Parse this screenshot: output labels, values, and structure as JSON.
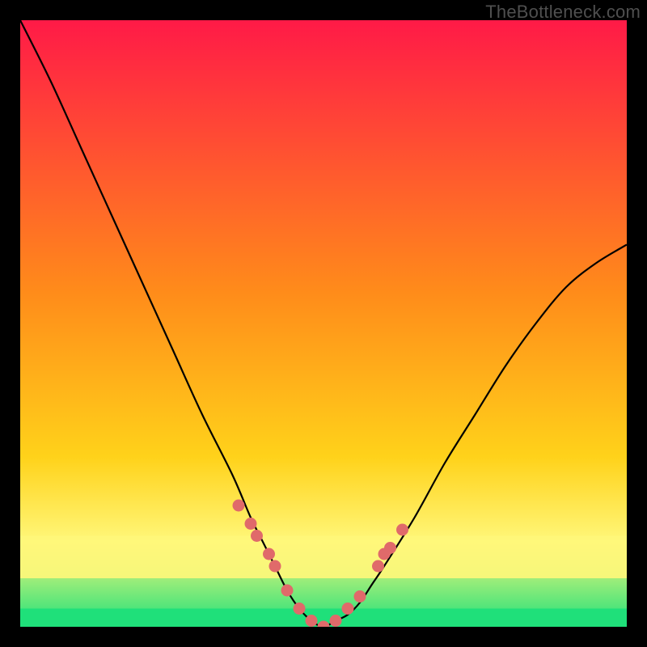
{
  "watermark": "TheBottleneck.com",
  "colors": {
    "frame": "#000000",
    "grad_top": "#ff1a47",
    "grad_mid": "#ffd21a",
    "grad_yellowband": "#fff77a",
    "grad_bottom": "#1fe07a",
    "curve": "#000000",
    "dots": "#e06a6a"
  },
  "chart_data": {
    "type": "line",
    "title": "",
    "xlabel": "",
    "ylabel": "",
    "xlim": [
      0,
      100
    ],
    "ylim": [
      0,
      100
    ],
    "series": [
      {
        "name": "bottleneck-curve",
        "x": [
          0,
          5,
          10,
          15,
          20,
          25,
          30,
          35,
          38,
          40,
          42,
          44,
          46,
          48,
          50,
          52,
          54,
          56,
          58,
          60,
          65,
          70,
          75,
          80,
          85,
          90,
          95,
          100
        ],
        "y": [
          100,
          90,
          79,
          68,
          57,
          46,
          35,
          25,
          18,
          14,
          10,
          6,
          3,
          1,
          0,
          1,
          2,
          4,
          7,
          10,
          18,
          27,
          35,
          43,
          50,
          56,
          60,
          63
        ]
      }
    ],
    "markers": {
      "name": "highlight-dots",
      "x": [
        36,
        38,
        39,
        41,
        42,
        44,
        46,
        48,
        50,
        52,
        54,
        56,
        59,
        60,
        61,
        63
      ],
      "y": [
        20,
        17,
        15,
        12,
        10,
        6,
        3,
        1,
        0,
        1,
        3,
        5,
        10,
        12,
        13,
        16
      ]
    },
    "bands": [
      {
        "name": "yellow-band",
        "y0": 8,
        "y1": 15,
        "color": "#fff77a"
      },
      {
        "name": "green-band",
        "y0": 0,
        "y1": 3,
        "color": "#1fe07a"
      }
    ]
  }
}
